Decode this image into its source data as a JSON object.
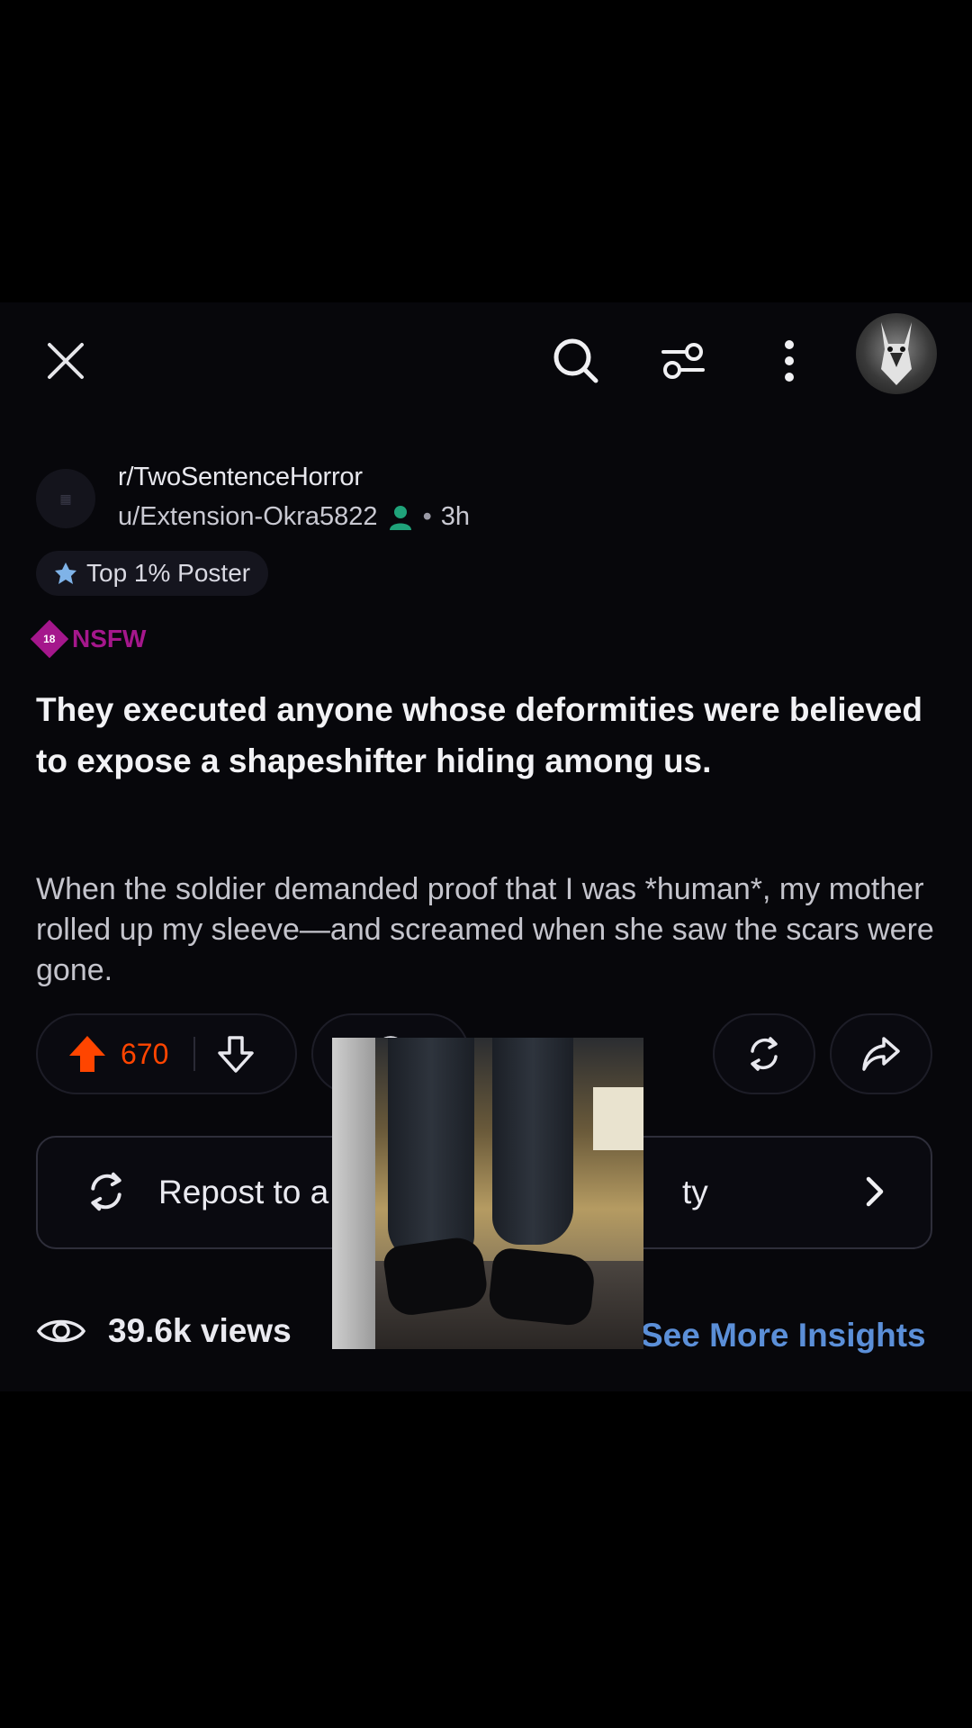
{
  "header": {
    "close_icon": "close-icon",
    "search_icon": "search-icon",
    "filter_icon": "filter-sliders-icon",
    "more_icon": "more-vertical-icon"
  },
  "post": {
    "subreddit": "r/TwoSentenceHorror",
    "author": "u/Extension-Okra5822",
    "separator": "•",
    "age": "3h",
    "badge": "Top 1% Poster",
    "nsfw_label": "NSFW",
    "nsfw_badge_number": "18",
    "title": "They executed anyone whose deformities were believed to expose a shapeshifter hiding among us.",
    "body": "When the soldier demanded proof that I was *human*, my mother rolled up my sleeve—and screamed when she saw the scars were gone.",
    "score": "670"
  },
  "repost": {
    "label": "Repost to a",
    "label_tail": "ty"
  },
  "stats": {
    "views": "39.6k views",
    "insights": "See More Insights"
  },
  "colors": {
    "upvote": "#ff4500",
    "nsfw": "#a5178c",
    "link": "#5b8fd8",
    "online": "#1fa37a"
  }
}
